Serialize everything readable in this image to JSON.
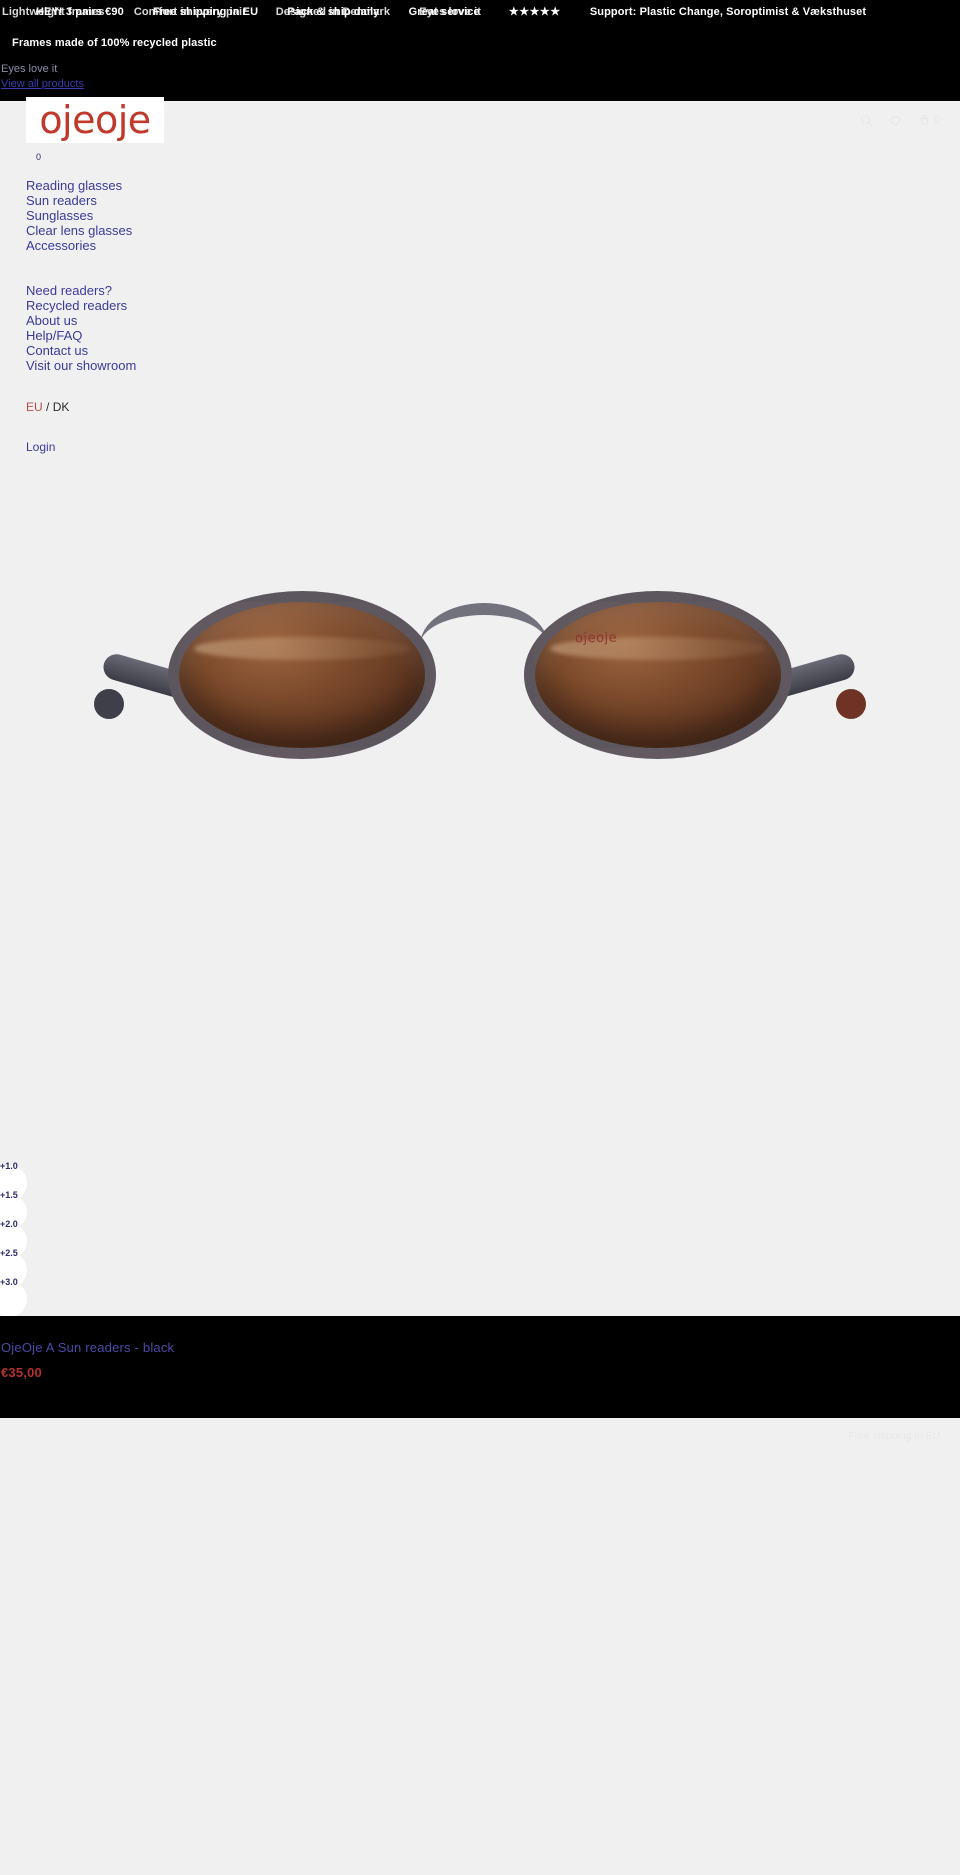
{
  "announcement": {
    "line_primary": [
      "HEY! 3 pairs €90",
      "Free shipping in EU",
      "Pack & ship daily",
      "Great service",
      "Support: Plastic Change, Soroptimist & Væksthuset"
    ],
    "line_overlay": [
      "Lightweight frames",
      "Comfort in every pair",
      "Designed in Denmark",
      "Eyes love it"
    ],
    "stars": "★★★★★",
    "recycled_line": "Frames made of 100% recycled plastic",
    "eyes_love_it": "Eyes love it",
    "view_all_products": "View all products"
  },
  "brand": {
    "logo_text": "ojeoje"
  },
  "header": {
    "search_label": "Search",
    "wishlist_label": "Wishlist",
    "cart_label": "Cart",
    "cart_count": "0"
  },
  "nav": {
    "primary": [
      {
        "label": "Reading glasses"
      },
      {
        "label": "Sun readers"
      },
      {
        "label": "Sunglasses"
      },
      {
        "label": "Clear lens glasses"
      },
      {
        "label": "Accessories"
      }
    ],
    "secondary": [
      {
        "label": "Need readers?"
      },
      {
        "label": "Recycled readers"
      },
      {
        "label": "About us"
      },
      {
        "label": "Help/FAQ"
      },
      {
        "label": "Contact us"
      },
      {
        "label": "Visit our showroom"
      }
    ],
    "locale": {
      "region": "EU",
      "separator": "/",
      "country": "DK"
    },
    "login_label": "Login"
  },
  "product": {
    "title": "OjeOje A Sun readers - black",
    "price": "€35,00",
    "lens_brand_mark": "ojeoje",
    "strengths": [
      {
        "label": "+1.0"
      },
      {
        "label": "+1.5"
      },
      {
        "label": "+2.0"
      },
      {
        "label": "+2.5"
      },
      {
        "label": "+3.0"
      }
    ]
  },
  "footer": {
    "note": "Free shipping in EU"
  }
}
